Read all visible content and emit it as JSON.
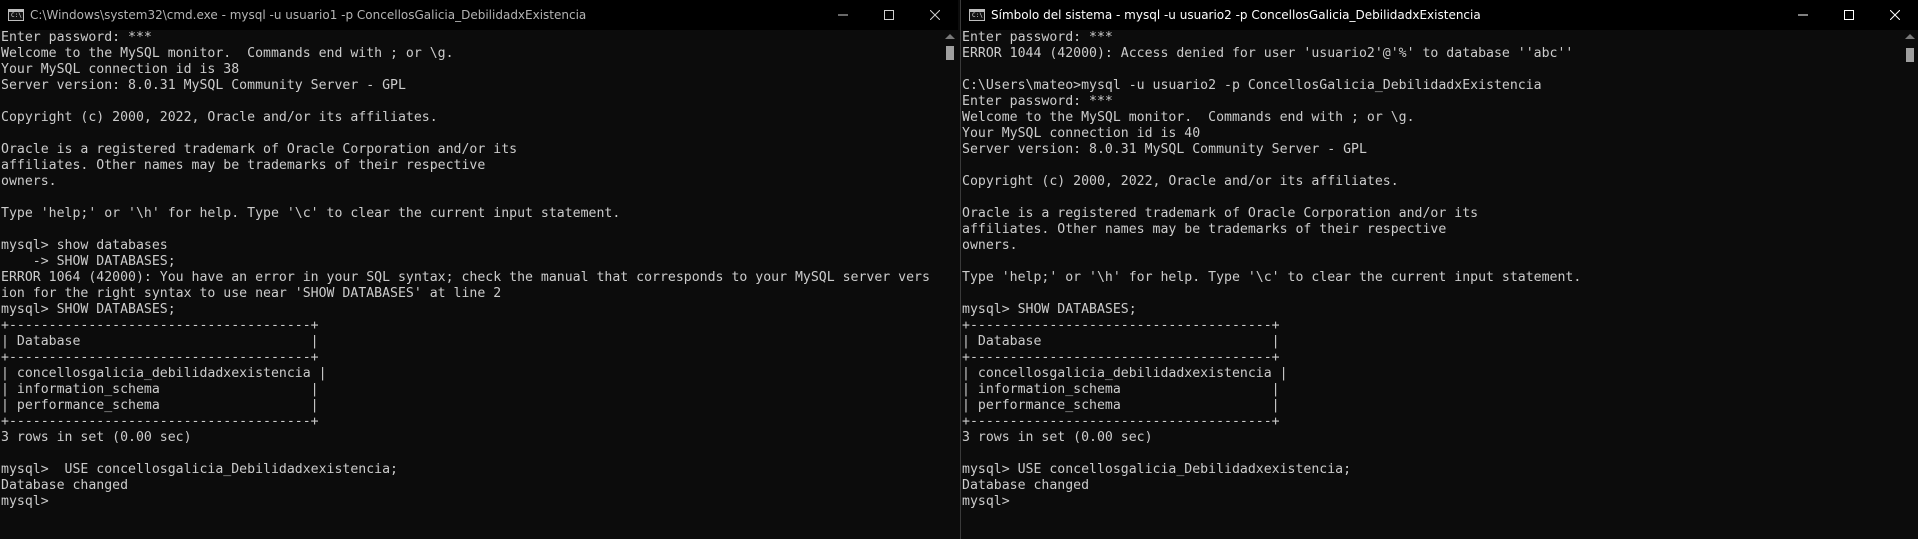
{
  "left_window": {
    "title": "C:\\Windows\\system32\\cmd.exe - mysql  -u usuario1 -p ConcellosGalicia_DebilidadxExistencia",
    "icon": "cmd-icon",
    "lines": [
      "Enter password: ***",
      "Welcome to the MySQL monitor.  Commands end with ; or \\g.",
      "Your MySQL connection id is 38",
      "Server version: 8.0.31 MySQL Community Server - GPL",
      "",
      "Copyright (c) 2000, 2022, Oracle and/or its affiliates.",
      "",
      "Oracle is a registered trademark of Oracle Corporation and/or its",
      "affiliates. Other names may be trademarks of their respective",
      "owners.",
      "",
      "Type 'help;' or '\\h' for help. Type '\\c' to clear the current input statement.",
      "",
      "mysql> show databases",
      "    -> SHOW DATABASES;",
      "ERROR 1064 (42000): You have an error in your SQL syntax; check the manual that corresponds to your MySQL server vers",
      "ion for the right syntax to use near 'SHOW DATABASES' at line 2",
      "mysql> SHOW DATABASES;",
      "+--------------------------------------+",
      "| Database                             |",
      "+--------------------------------------+",
      "| concellosgalicia_debilidadxexistencia |",
      "| information_schema                   |",
      "| performance_schema                   |",
      "+--------------------------------------+",
      "3 rows in set (0.00 sec)",
      "",
      "mysql>  USE concellosgalicia_Debilidadxexistencia;",
      "Database changed",
      "mysql>"
    ]
  },
  "right_window": {
    "title": "Símbolo del sistema - mysql  -u usuario2 -p ConcellosGalicia_DebilidadxExistencia",
    "icon": "cmd-icon",
    "lines": [
      "Enter password: ***",
      "ERROR 1044 (42000): Access denied for user 'usuario2'@'%' to database ''abc''",
      "",
      "C:\\Users\\mateo>mysql -u usuario2 -p ConcellosGalicia_DebilidadxExistencia",
      "Enter password: ***",
      "Welcome to the MySQL monitor.  Commands end with ; or \\g.",
      "Your MySQL connection id is 40",
      "Server version: 8.0.31 MySQL Community Server - GPL",
      "",
      "Copyright (c) 2000, 2022, Oracle and/or its affiliates.",
      "",
      "Oracle is a registered trademark of Oracle Corporation and/or its",
      "affiliates. Other names may be trademarks of their respective",
      "owners.",
      "",
      "Type 'help;' or '\\h' for help. Type '\\c' to clear the current input statement.",
      "",
      "mysql> SHOW DATABASES;",
      "+--------------------------------------+",
      "| Database                             |",
      "+--------------------------------------+",
      "| concellosgalicia_debilidadxexistencia |",
      "| information_schema                   |",
      "| performance_schema                   |",
      "+--------------------------------------+",
      "3 rows in set (0.00 sec)",
      "",
      "mysql> USE concellosgalicia_Debilidadxexistencia;",
      "Database changed",
      "mysql>"
    ]
  },
  "colors": {
    "console_bg": "#0c0c0c",
    "console_text": "#cccccc",
    "titlebar_bg": "#000000"
  }
}
